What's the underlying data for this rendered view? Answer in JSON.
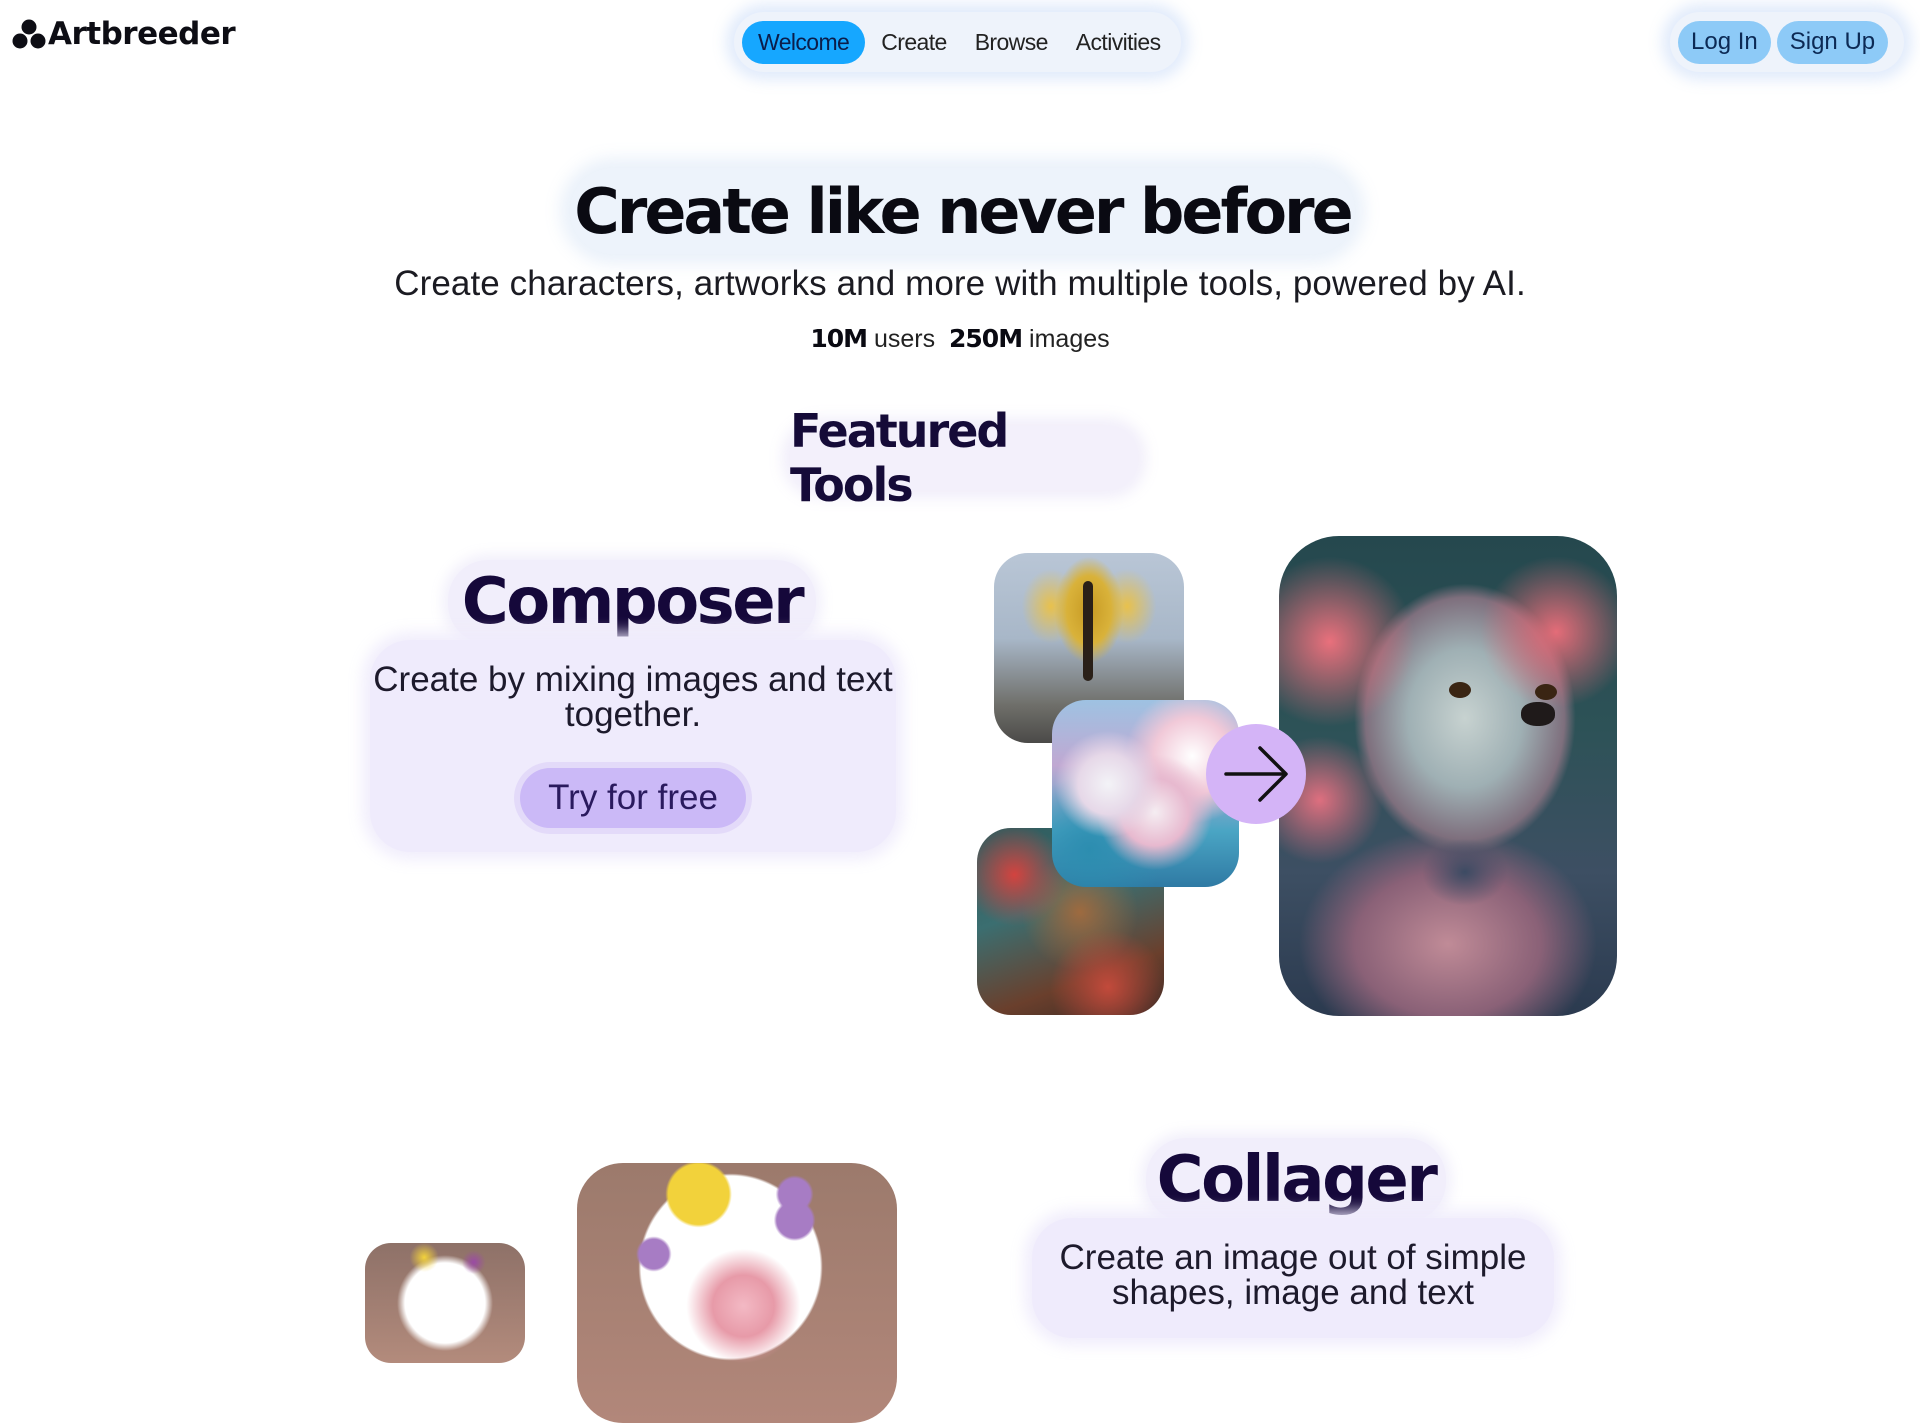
{
  "header": {
    "logo_text": "Artbreeder",
    "nav": [
      {
        "label": "Welcome",
        "active": true
      },
      {
        "label": "Create",
        "active": false
      },
      {
        "label": "Browse",
        "active": false
      },
      {
        "label": "Activities",
        "active": false
      }
    ],
    "login_label": "Log In",
    "signup_label": "Sign Up"
  },
  "hero": {
    "title": "Create like never before",
    "subtitle": "Create characters, artworks and more with multiple tools, powered by AI.",
    "stats": {
      "users_value": "10M",
      "users_label": "users",
      "images_value": "250M",
      "images_label": "images"
    }
  },
  "featured": {
    "title": "Featured Tools",
    "composer": {
      "title": "Composer",
      "description": "Create by mixing images and text together.",
      "cta": "Try for free"
    },
    "collager": {
      "title": "Collager",
      "description": "Create an image out of simple shapes, image and text"
    }
  },
  "icons": {
    "logo": "artbreeder-logo-icon",
    "arrow": "arrow-right-icon"
  },
  "colors": {
    "nav_active": "#16a7ff",
    "auth_button": "#8dcaf7",
    "cta_button": "#cbb9f7",
    "card_bg": "#efebfc",
    "arrow_circle": "#d4b4f7",
    "title_text": "#15083a"
  }
}
